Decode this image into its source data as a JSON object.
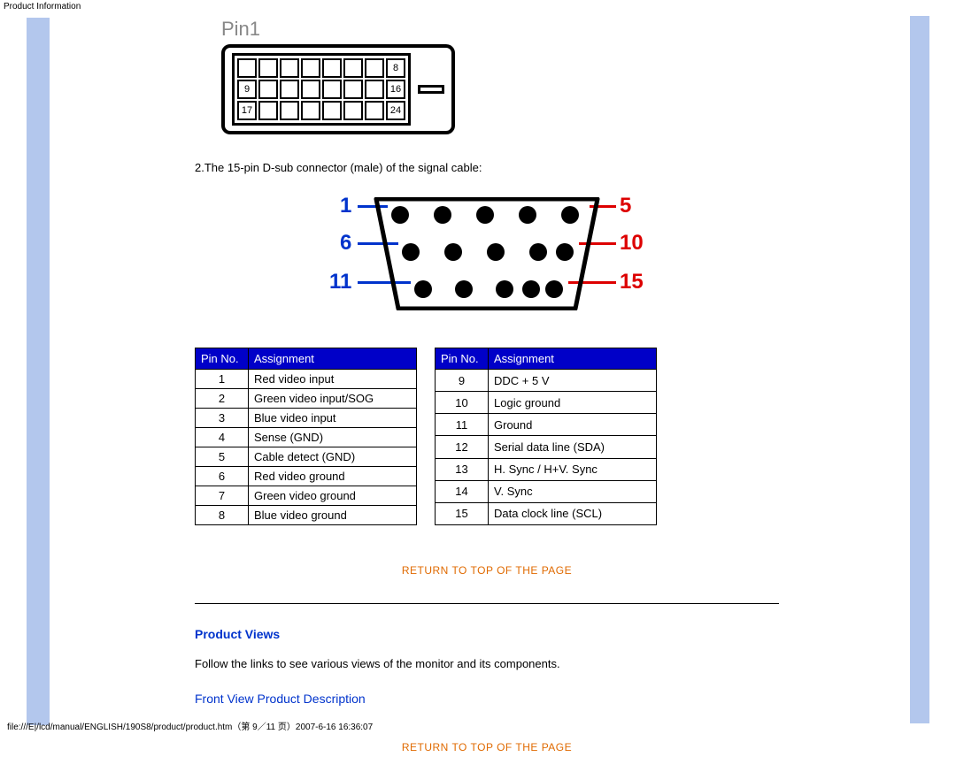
{
  "header": "Product Information",
  "footer": "file:///E|/lcd/manual/ENGLISH/190S8/product/product.htm（第 9／11 页）2007-6-16 16:36:07",
  "dvi": {
    "pin1_label": "Pin1"
  },
  "intro_text": "2.The 15-pin D-sub connector (male) of the signal cable:",
  "dsub_labels": {
    "n1": "1",
    "n5": "5",
    "n6": "6",
    "n10": "10",
    "n11": "11",
    "n15": "15"
  },
  "table_headers": {
    "pin_no": "Pin No.",
    "assignment": "Assignment"
  },
  "pins_left": [
    {
      "n": "1",
      "a": "Red video input"
    },
    {
      "n": "2",
      "a": "Green video input/SOG"
    },
    {
      "n": "3",
      "a": "Blue video input"
    },
    {
      "n": "4",
      "a": "Sense (GND)"
    },
    {
      "n": "5",
      "a": "Cable detect (GND)"
    },
    {
      "n": "6",
      "a": "Red video ground"
    },
    {
      "n": "7",
      "a": "Green video ground"
    },
    {
      "n": "8",
      "a": "Blue video ground"
    }
  ],
  "pins_right": [
    {
      "n": "9",
      "a": "DDC + 5 V"
    },
    {
      "n": "10",
      "a": "Logic ground"
    },
    {
      "n": "11",
      "a": "Ground"
    },
    {
      "n": "12",
      "a": "Serial data line (SDA)"
    },
    {
      "n": "13",
      "a": "H. Sync / H+V. Sync"
    },
    {
      "n": "14",
      "a": "V. Sync"
    },
    {
      "n": "15",
      "a": "Data clock line (SCL)"
    }
  ],
  "return_link": "RETURN TO TOP OF THE PAGE",
  "product_views": {
    "heading": "Product Views",
    "body": "Follow the links to see various views of the monitor and its components.",
    "link": "Front View Product Description"
  }
}
